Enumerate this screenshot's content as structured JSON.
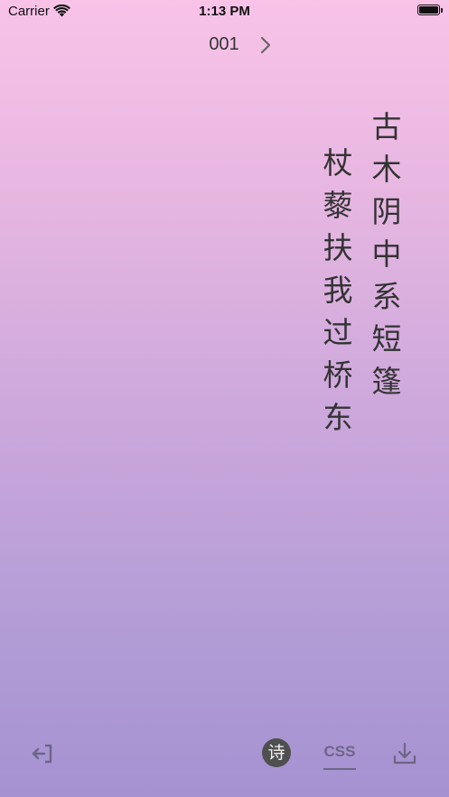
{
  "status_bar": {
    "carrier": "Carrier",
    "time": "1:13 PM"
  },
  "header": {
    "page_number": "001",
    "next_icon": "chevron-right-icon"
  },
  "poem": {
    "columns": [
      [
        "古",
        "木",
        "阴",
        "中",
        "系",
        "短",
        "篷"
      ],
      [
        "杖",
        "藜",
        "扶",
        "我",
        "过",
        "桥",
        "东"
      ]
    ]
  },
  "toolbar": {
    "exit_icon": "exit-icon",
    "poem_label": "诗",
    "css_label": "CSS",
    "download_icon": "download-icon"
  },
  "colors": {
    "gradient_top": "#f9c3e8",
    "gradient_bottom": "#a592d1",
    "text": "#333333",
    "icon": "#6d6585"
  }
}
